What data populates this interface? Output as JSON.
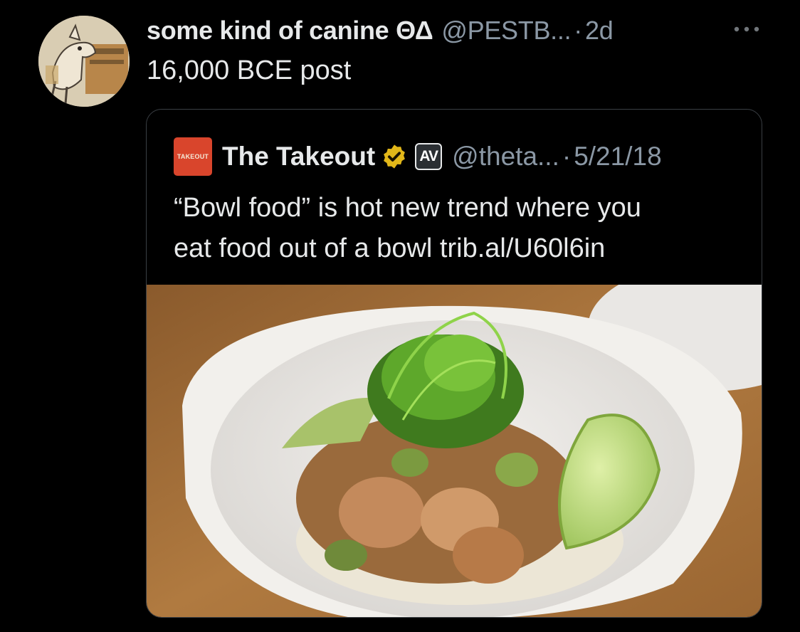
{
  "post": {
    "author_name": "some kind of canine ΘΔ",
    "author_handle": "@PESTB...",
    "separator": "·",
    "time": "2d",
    "text": "16,000 BCE post"
  },
  "quoted_post": {
    "logo_text": "TAKEOUT",
    "author_name": "The Takeout",
    "badge_text": "AV",
    "author_handle": "@theta...",
    "separator": "·",
    "date": "5/21/18",
    "text_line_1": "“Bowl food” is hot new trend where you",
    "text_line_2": "eat food out of a bowl trib.al/U60l6in"
  },
  "icons": {
    "more": "more-horizontal-icon",
    "verified": "verified-gold-badge-icon"
  },
  "colors": {
    "background": "#000000",
    "text_primary": "#e7e9ea",
    "text_secondary": "#8b98a5",
    "quote_border": "#3a3f44",
    "verified_gold": "#e2b719",
    "takeout_red": "#d9452c"
  }
}
